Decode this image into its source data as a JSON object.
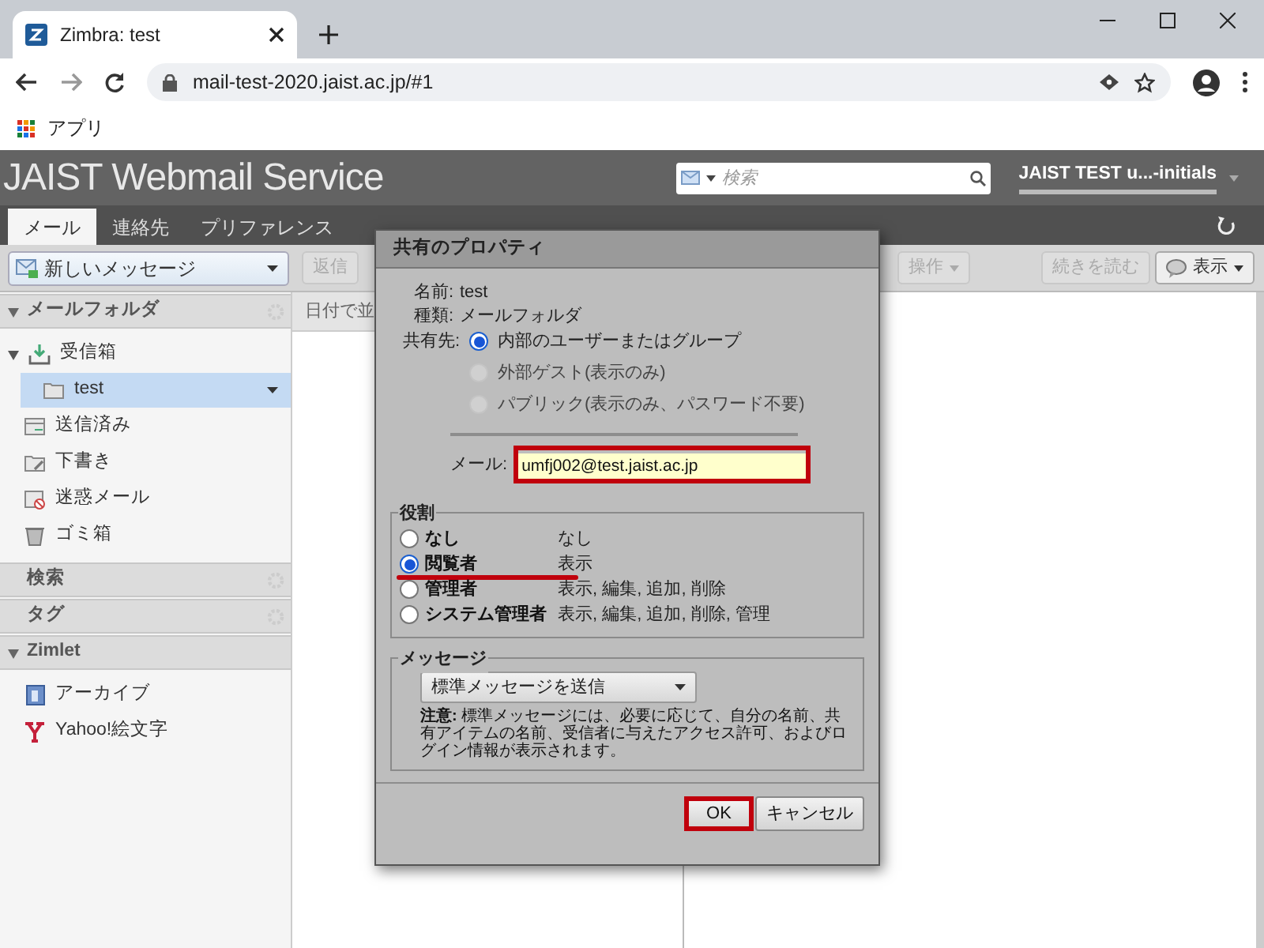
{
  "browser": {
    "tab_title": "Zimbra: test",
    "url": "mail-test-2020.jaist.ac.jp/#1",
    "bookmark": "アプリ"
  },
  "header": {
    "logo": "JAIST Webmail Service",
    "search": {
      "placeholder": "検索"
    },
    "user": "JAIST TEST u...-initials"
  },
  "app_tabs": [
    {
      "label": "メール",
      "selected": true
    },
    {
      "label": "連絡先",
      "selected": false
    },
    {
      "label": "プリファレンス",
      "selected": false
    }
  ],
  "toolbar": {
    "new_message": "新しいメッセージ",
    "buttons": [
      {
        "label": "返信",
        "disabled": true
      },
      {
        "label": "操作",
        "disabled": true,
        "dropdown": true
      },
      {
        "label": "続きを読む",
        "disabled": true
      },
      {
        "label": "表示",
        "disabled": false,
        "dropdown": true
      }
    ]
  },
  "sidebar": {
    "sections": [
      {
        "title": "メールフォルダ",
        "expanded": true,
        "items": [
          {
            "label": "受信箱",
            "kind": "inbox",
            "expanded": true,
            "selected": false,
            "children": [
              {
                "label": "test",
                "kind": "folder",
                "selected": true
              }
            ]
          },
          {
            "label": "送信済み",
            "kind": "sent",
            "selected": false
          },
          {
            "label": "下書き",
            "kind": "drafts",
            "selected": false
          },
          {
            "label": "迷惑メール",
            "kind": "junk",
            "selected": false
          },
          {
            "label": "ゴミ箱",
            "kind": "trash",
            "selected": false
          }
        ]
      },
      {
        "title": "検索",
        "expanded": false
      },
      {
        "title": "タグ",
        "expanded": false
      },
      {
        "title": "Zimlet",
        "expanded": true,
        "items": [
          {
            "label": "アーカイブ",
            "kind": "archive",
            "selected": false
          },
          {
            "label": "Yahoo!絵文字",
            "kind": "yahoo",
            "selected": false
          }
        ]
      }
    ]
  },
  "list": {
    "sort_label": "日付で並"
  },
  "dialog": {
    "title": "共有のプロパティ",
    "info": [
      {
        "label": "名前:",
        "value": "test"
      },
      {
        "label": "種類:",
        "value": "メールフォルダ"
      }
    ],
    "share_with": {
      "label": "共有先:",
      "options": [
        {
          "label": "内部のユーザーまたはグループ",
          "selected": true,
          "disabled": false
        },
        {
          "label": "外部ゲスト(表示のみ)",
          "selected": false,
          "disabled": true
        },
        {
          "label": "パブリック(表示のみ、パスワード不要)",
          "selected": false,
          "disabled": true
        }
      ]
    },
    "email": {
      "label": "メール:",
      "value": "umfj002@test.jaist.ac.jp",
      "highlighted": true
    },
    "role": {
      "legend": "役割",
      "options": [
        {
          "label": "なし",
          "rights": "なし",
          "selected": false,
          "underlined": false
        },
        {
          "label": "閲覧者",
          "rights": "表示",
          "selected": true,
          "underlined": true
        },
        {
          "label": "管理者",
          "rights": "表示, 編集, 追加, 削除",
          "selected": false,
          "underlined": false
        },
        {
          "label": "システム管理者",
          "rights": "表示, 編集, 追加, 削除, 管理",
          "selected": false,
          "underlined": false
        }
      ]
    },
    "message": {
      "legend": "メッセージ",
      "dropdown": "標準メッセージを送信",
      "note": "**注意:** 標準メッセージには、必要に応じて、自分の名前、共有アイテムの名前、受信者に与えたアクセス許可、およびログイン情報が表示されます。"
    },
    "buttons": [
      {
        "label": "OK",
        "highlighted": true
      },
      {
        "label": "キャンセル",
        "highlighted": false
      }
    ]
  }
}
